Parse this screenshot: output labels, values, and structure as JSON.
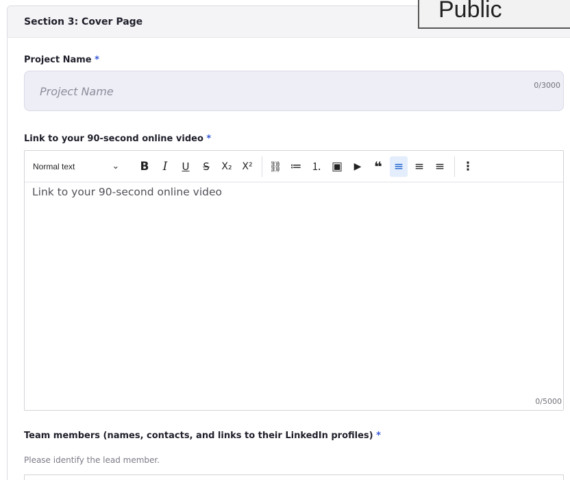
{
  "badge": {
    "label": "Public"
  },
  "section": {
    "title": "Section 3:  Cover Page"
  },
  "project_name": {
    "label": "Project Name",
    "required_mark": "*",
    "placeholder": "Project Name",
    "value": "",
    "counter": "0/3000"
  },
  "video_link": {
    "label": "Link to your 90-second online video",
    "required_mark": "*",
    "toolbar": {
      "paragraph_style": "Normal text",
      "buttons": [
        {
          "name": "bold",
          "glyph": "B"
        },
        {
          "name": "italic",
          "glyph": "I"
        },
        {
          "name": "underline",
          "glyph": "U"
        },
        {
          "name": "strikethrough",
          "glyph": "S"
        },
        {
          "name": "subscript",
          "glyph": "X₂"
        },
        {
          "name": "superscript",
          "glyph": "X²"
        },
        {
          "name": "link",
          "glyph": "⛓"
        },
        {
          "name": "bulleted-list",
          "glyph": "≔"
        },
        {
          "name": "numbered-list",
          "glyph": "⒈"
        },
        {
          "name": "image",
          "glyph": "▣"
        },
        {
          "name": "video",
          "glyph": "▶"
        },
        {
          "name": "quote",
          "glyph": "❝"
        },
        {
          "name": "align-left",
          "glyph": "≡"
        },
        {
          "name": "align-center",
          "glyph": "≡"
        },
        {
          "name": "align-right",
          "glyph": "≡"
        },
        {
          "name": "more-options",
          "glyph": "⋮"
        }
      ]
    },
    "placeholder": "Link to your 90-second online video",
    "counter": "0/5000"
  },
  "team_members": {
    "label": "Team members (names, contacts, and links to their LinkedIn profiles)",
    "required_mark": "*",
    "help": "Please identify the lead member."
  }
}
